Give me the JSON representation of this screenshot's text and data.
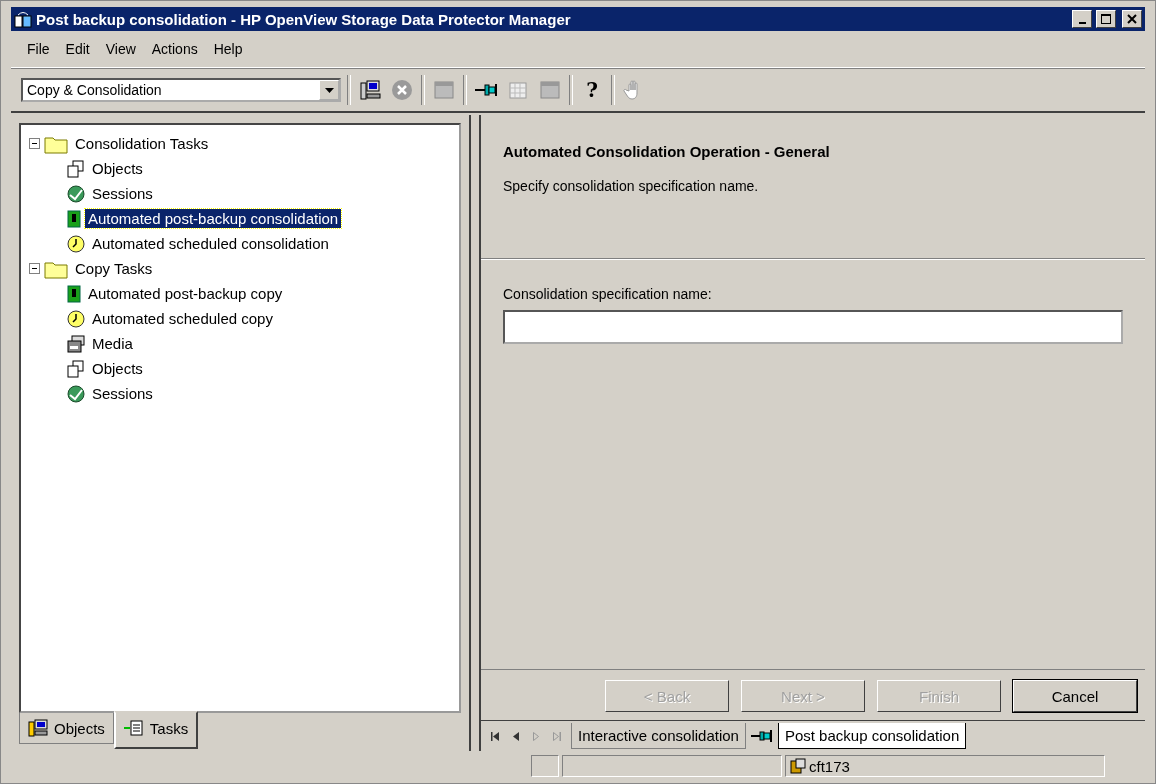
{
  "window": {
    "title": "Post backup consolidation - HP OpenView Storage Data Protector Manager"
  },
  "menu": [
    "File",
    "Edit",
    "View",
    "Actions",
    "Help"
  ],
  "toolbar": {
    "context": "Copy & Consolidation",
    "help_glyph": "?"
  },
  "tree": [
    {
      "label": "Consolidation Tasks",
      "kind": "folder",
      "expanded": true,
      "selected": false,
      "children": [
        {
          "label": "Objects",
          "kind": "objects",
          "selected": false
        },
        {
          "label": "Sessions",
          "kind": "sessions",
          "selected": false
        },
        {
          "label": "Automated post-backup consolidation",
          "kind": "postbackup",
          "selected": true
        },
        {
          "label": "Automated scheduled consolidation",
          "kind": "clock",
          "selected": false
        }
      ]
    },
    {
      "label": "Copy Tasks",
      "kind": "folder",
      "expanded": true,
      "selected": false,
      "children": [
        {
          "label": "Automated post-backup copy",
          "kind": "postbackup",
          "selected": false
        },
        {
          "label": "Automated scheduled copy",
          "kind": "clock",
          "selected": false
        },
        {
          "label": "Media",
          "kind": "media",
          "selected": false
        },
        {
          "label": "Objects",
          "kind": "objects",
          "selected": false
        },
        {
          "label": "Sessions",
          "kind": "sessions",
          "selected": false
        }
      ]
    }
  ],
  "left_tabs": [
    {
      "label": "Objects",
      "selected": false
    },
    {
      "label": "Tasks",
      "selected": true
    }
  ],
  "wizard": {
    "heading": "Automated Consolidation Operation - General",
    "description": "Specify consolidation specification name.",
    "field_label": "Consolidation specification name:",
    "buttons": [
      {
        "label": "< Back",
        "disabled": true
      },
      {
        "label": "Next >",
        "disabled": true
      },
      {
        "label": "Finish",
        "disabled": true
      },
      {
        "label": "Cancel",
        "disabled": false
      }
    ]
  },
  "doc_tabs": [
    {
      "label": "Interactive consolidation",
      "selected": false
    },
    {
      "label": "Post backup consolidation",
      "selected": true
    }
  ],
  "status_bar": {
    "host": "cft173"
  }
}
